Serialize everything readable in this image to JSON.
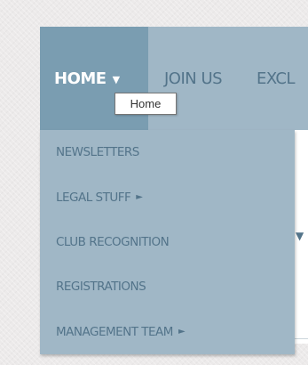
{
  "nav": {
    "items": [
      {
        "label": "HOME",
        "active": true,
        "has_submenu": true
      },
      {
        "label": "JOIN US",
        "active": false
      },
      {
        "label": "EXCL",
        "active": false
      }
    ],
    "caret_icon": "caret-down-icon"
  },
  "dropdown": {
    "items": [
      {
        "label": "NEWSLETTERS",
        "has_submenu": false
      },
      {
        "label": "LEGAL STUFF",
        "has_submenu": true
      },
      {
        "label": "CLUB RECOGNITION",
        "has_submenu": false
      },
      {
        "label": "REGISTRATIONS",
        "has_submenu": false
      },
      {
        "label": "MANAGEMENT TEAM",
        "has_submenu": true
      }
    ],
    "submenu_icon": "caret-right-icon"
  },
  "tooltip": {
    "text": "Home"
  },
  "colors": {
    "nav_bg": "#a0b7c6",
    "nav_active_bg": "#7a9db1",
    "nav_text": "#53748a",
    "nav_active_text": "#ffffff",
    "page_bg": "#eceaea"
  }
}
